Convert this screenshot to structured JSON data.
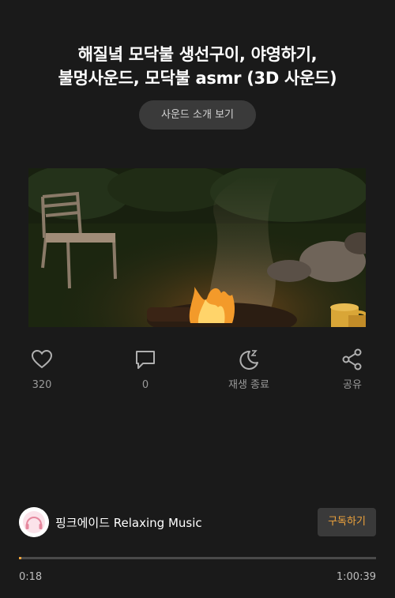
{
  "video": {
    "title_line1": "해질녘 모닥불 생선구이, 야영하기,",
    "title_line2": "불멍사운드, 모닥불 asmr (3D 사운드)",
    "intro_button_label": "사운드 소개 보기"
  },
  "actions": [
    {
      "icon": "heart-icon",
      "label": "320"
    },
    {
      "icon": "comment-icon",
      "label": "0"
    },
    {
      "icon": "sleep-timer-icon",
      "label": "재생 종료"
    },
    {
      "icon": "share-icon",
      "label": "공유"
    }
  ],
  "channel": {
    "name": "핑크에이드 Relaxing Music",
    "subscribe_label": "구독하기",
    "avatar_icon": "headphones-logo"
  },
  "player": {
    "current_time": "0:18",
    "total_time": "1:00:39",
    "progress_fraction": 0.005
  },
  "colors": {
    "background": "#1a1a1a",
    "accent": "#f0a43c",
    "button_bg": "#3a3a3a"
  }
}
